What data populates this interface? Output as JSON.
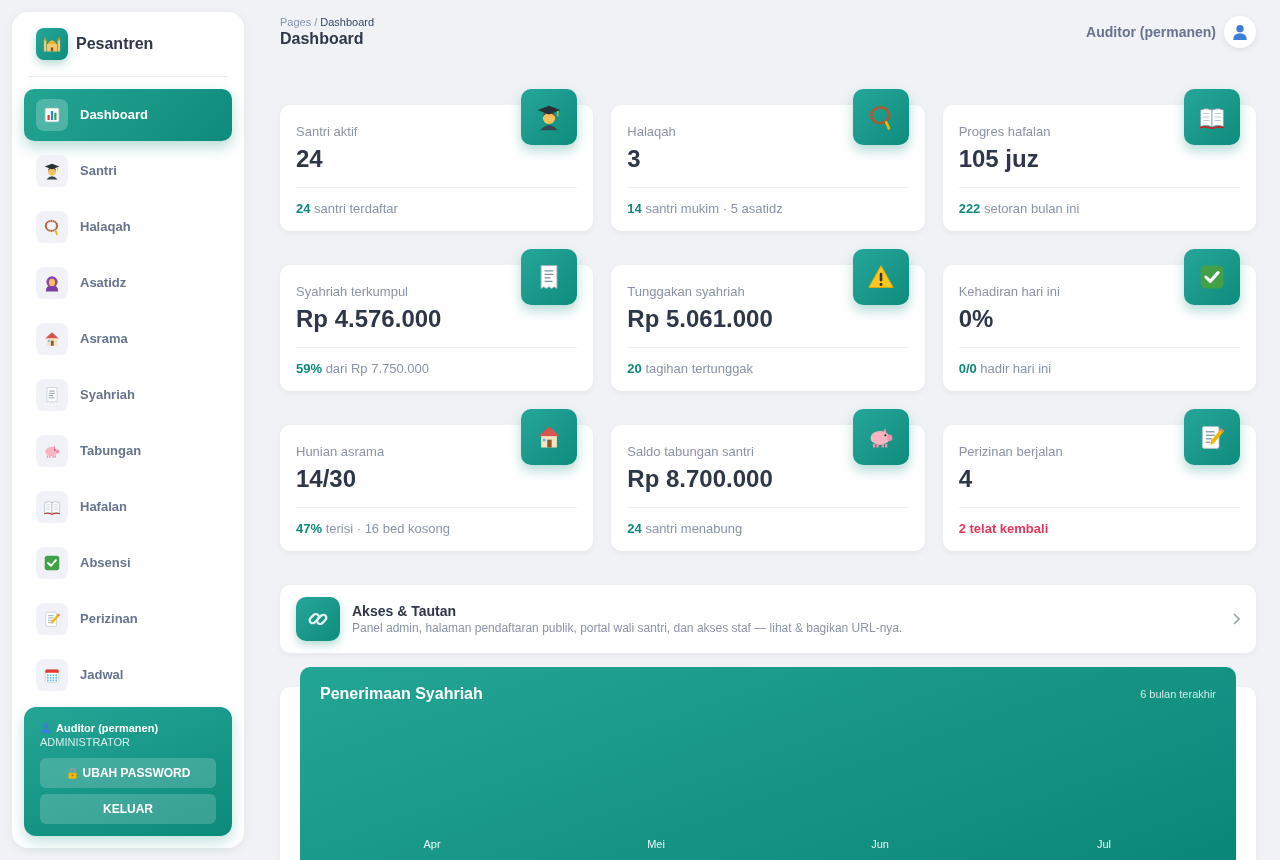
{
  "sidebar": {
    "brand": "Pesantren",
    "nav": [
      {
        "label": "Dashboard",
        "selected": true
      },
      {
        "label": "Santri",
        "selected": false
      },
      {
        "label": "Halaqah",
        "selected": false
      },
      {
        "label": "Asatidz",
        "selected": false
      },
      {
        "label": "Asrama",
        "selected": false
      },
      {
        "label": "Syahriah",
        "selected": false
      },
      {
        "label": "Tabungan",
        "selected": false
      },
      {
        "label": "Hafalan",
        "selected": false
      },
      {
        "label": "Absensi",
        "selected": false
      },
      {
        "label": "Perizinan",
        "selected": false
      },
      {
        "label": "Jadwal",
        "selected": false
      }
    ],
    "user": {
      "name": "Auditor (permanen)",
      "role": "ADMINISTRATOR",
      "buttons": [
        {
          "label": "UBAH PASSWORD",
          "kind": "password"
        },
        {
          "label": "KELUAR",
          "kind": "logout"
        }
      ]
    }
  },
  "header": {
    "breadcrumb": [
      {
        "label": "Pages",
        "current": false
      },
      {
        "label": "Dashboard",
        "current": true
      }
    ],
    "separator": "/",
    "title": "Dashboard",
    "user_name": "Auditor (permanen)"
  },
  "stats": [
    {
      "label": "Santri aktif",
      "value": "24",
      "footer": "**24** santri terdaftar",
      "alert": false
    },
    {
      "label": "Halaqah",
      "value": "3",
      "footer": "**14** santri mukim · 5 asatidz",
      "alert": false
    },
    {
      "label": "Progres hafalan",
      "value": "105 juz",
      "footer": "**222** setoran bulan ini",
      "alert": false
    },
    {
      "label": "Syahriah terkumpul",
      "value": "Rp 4.576.000",
      "footer": "**59%** dari Rp 7.750.000",
      "alert": false
    },
    {
      "label": "Tunggakan syahriah",
      "value": "Rp 5.061.000",
      "footer": "**20** tagihan tertunggak",
      "alert": false
    },
    {
      "label": "Kehadiran hari ini",
      "value": "0%",
      "footer": "**0/0** hadir hari ini",
      "alert": false
    },
    {
      "label": "Hunian asrama",
      "value": "14/30",
      "footer": "**47%** terisi · 16 bed kosong",
      "alert": false
    },
    {
      "label": "Saldo tabungan santri",
      "value": "Rp 8.700.000",
      "footer": "**24** santri menabung",
      "alert": false
    },
    {
      "label": "Perizinan berjalan",
      "value": "4",
      "footer": "2 telat kembali",
      "alert": true
    }
  ],
  "links_card": {
    "title": "Akses & Tautan",
    "description": "Panel admin, halaman pendaftaran publik, portal wali santri, dan akses staf — lihat & bagikan URL-nya."
  },
  "chart": {
    "title": "Penerimaan Syahriah",
    "subtitle": "6 bulan terakhir",
    "months": [
      "Apr",
      "Mei",
      "Jun",
      "Jul"
    ]
  }
}
